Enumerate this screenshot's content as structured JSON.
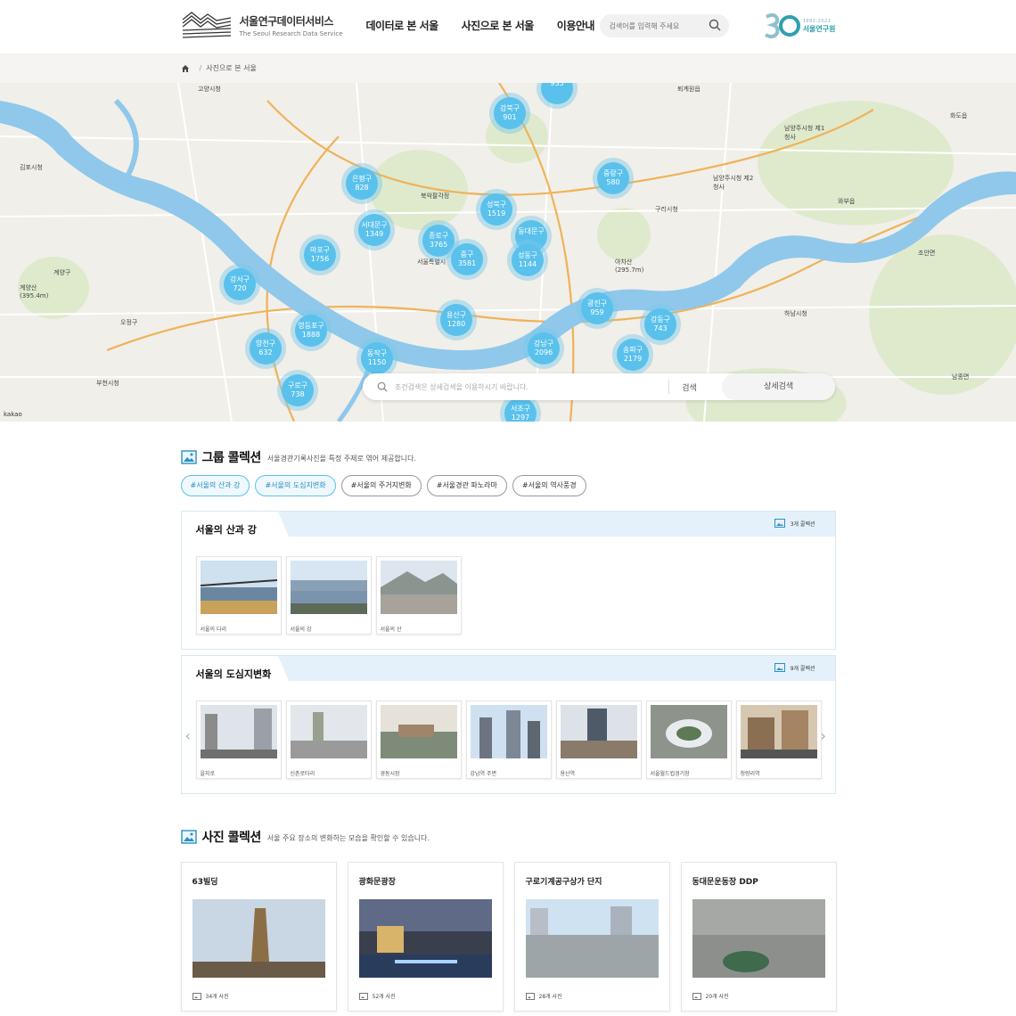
{
  "header": {
    "logo_kr": "서울연구데이터서비스",
    "logo_en": "The Seoul Research Data Service",
    "nav": [
      "데이터로 본 서울",
      "사진으로 본 서울",
      "이용안내"
    ],
    "search_placeholder": "검색어를 입력해 주세요",
    "institute_years": "1992-2022",
    "institute_name": "서울연구원"
  },
  "breadcrumb": {
    "current": "사진으로 본 서울",
    "sep": "/"
  },
  "map": {
    "clusters": [
      {
        "name": "",
        "count": "935"
      },
      {
        "name": "강북구",
        "count": "901"
      },
      {
        "name": "중랑구",
        "count": "580"
      },
      {
        "name": "은평구",
        "count": "828"
      },
      {
        "name": "성북구",
        "count": "1519"
      },
      {
        "name": "서대문구",
        "count": "1349"
      },
      {
        "name": "종로구",
        "count": "3765"
      },
      {
        "name": "동대문구",
        "count": ""
      },
      {
        "name": "마포구",
        "count": "1756"
      },
      {
        "name": "중구",
        "count": "3581"
      },
      {
        "name": "성동구",
        "count": "1144"
      },
      {
        "name": "강서구",
        "count": "720"
      },
      {
        "name": "광진구",
        "count": "959"
      },
      {
        "name": "용산구",
        "count": "1280"
      },
      {
        "name": "강동구",
        "count": "743"
      },
      {
        "name": "영등포구",
        "count": "1888"
      },
      {
        "name": "양천구",
        "count": "632"
      },
      {
        "name": "강남구",
        "count": "2096"
      },
      {
        "name": "송파구",
        "count": "2179"
      },
      {
        "name": "동작구",
        "count": "1150"
      },
      {
        "name": "구로구",
        "count": "738"
      },
      {
        "name": "서초구",
        "count": "1297"
      }
    ],
    "places": [
      "고양시청",
      "퇴계원읍",
      "김포시청",
      "남양주시청 제1청사",
      "남양주시청 제2청사",
      "구리시청",
      "계양구",
      "와부읍",
      "조안면",
      "하남시청",
      "서울특별시",
      "부천시청",
      "오정구",
      "남종면",
      "아차산 (295.7m)",
      "계양산 (395.4m)",
      "북악팔각정",
      "화도읍"
    ],
    "search_placeholder": "조건검색은 상세검색을 이용하시기 바랍니다.",
    "search_btn": "검색",
    "advanced_btn": "상세검색",
    "attribution": "kakao"
  },
  "group_section": {
    "title": "그룹 콜렉션",
    "subtitle": "서울경관기록사진을 특정 주제로 엮어 제공합니다.",
    "tags": [
      "#서울의 산과 강",
      "#서울의 도심지변화",
      "#서울의 주거지변화",
      "#서울경관 파노라마",
      "#서울의 역사풍경"
    ],
    "groups": [
      {
        "name": "서울의 산과 강",
        "count": "3개 콜렉션",
        "items": [
          "서울의 다리",
          "서울의 강",
          "서울의 산"
        ]
      },
      {
        "name": "서울의 도심지변화",
        "count": "9개 콜렉션",
        "items": [
          "을지로",
          "신촌로타리",
          "경동시장",
          "강남역 주변",
          "용산역",
          "서울월드컵경기장",
          "청량리역"
        ]
      }
    ]
  },
  "photo_section": {
    "title": "사진 콜렉션",
    "subtitle": "서울 주요 장소의 변화하는 모습을 확인할 수 있습니다.",
    "cards": [
      {
        "title": "63빌딩",
        "count": "34개 사진"
      },
      {
        "title": "광화문광장",
        "count": "52개 사진"
      },
      {
        "title": "구로기계공구상가 단지",
        "count": "28개 사진"
      },
      {
        "title": "동대문운동장 DDP",
        "count": "20개 사진"
      }
    ]
  },
  "colors": {
    "accent": "#5ac1ec",
    "brand": "#2f9fb0",
    "river": "#8fc8ea"
  }
}
